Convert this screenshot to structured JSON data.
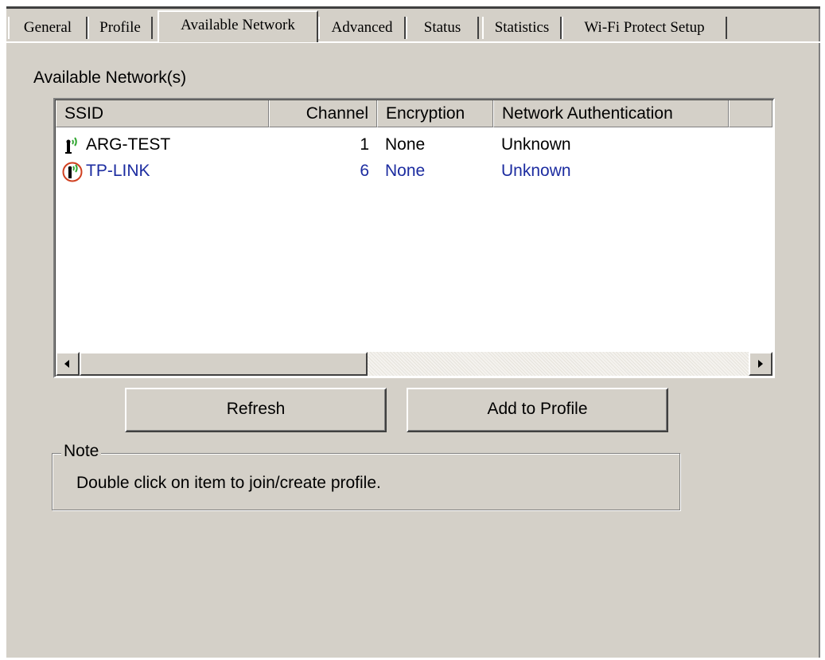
{
  "tabs": [
    {
      "label": "General",
      "active": false
    },
    {
      "label": "Profile",
      "active": false
    },
    {
      "label": "Available Network",
      "active": true
    },
    {
      "label": "Advanced",
      "active": false
    },
    {
      "label": "Status",
      "active": false
    },
    {
      "label": "Statistics",
      "active": false
    },
    {
      "label": "Wi-Fi Protect Setup",
      "active": false
    }
  ],
  "section_label": "Available Network(s)",
  "list": {
    "columns": [
      "SSID",
      "Channel",
      "Encryption",
      "Network Authentication"
    ],
    "rows": [
      {
        "ssid": "ARG-TEST",
        "channel": "1",
        "encryption": "None",
        "auth": "Unknown",
        "icon": "wifi-signal-icon",
        "color": "#000000"
      },
      {
        "ssid": "TP-LINK",
        "channel": "6",
        "encryption": "None",
        "auth": "Unknown",
        "icon": "wifi-signal-connected-icon",
        "color": "#1c2ca0"
      }
    ]
  },
  "buttons": {
    "refresh": "Refresh",
    "add_to_profile": "Add to Profile"
  },
  "note": {
    "title": "Note",
    "text": "Double click on item to join/create profile."
  },
  "colors": {
    "window_bg": "#d4d0c8",
    "selected_row_text": "#1c2ca0",
    "icon_ring": "#d04020",
    "signal_green": "#2fa52f"
  }
}
